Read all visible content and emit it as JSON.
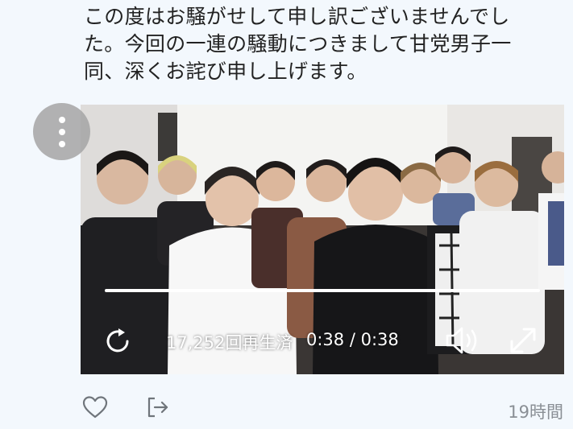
{
  "tweet": {
    "text_lines": [
      "この度はお騒がせして申し訳ございませんでし",
      "た。今回の一連の騒動につきまして甘党男子一",
      "同、深くお詫び申し上げます。"
    ],
    "timestamp": "19時間"
  },
  "video": {
    "view_count": "17,252回再生済",
    "elapsed": "0:38",
    "duration": "0:38",
    "time_display": "0:38 / 0:38",
    "progress": 1.0
  },
  "icons": {
    "more": "vertical-ellipsis-icon",
    "replay": "replay-icon",
    "volume": "speaker-icon",
    "fullscreen": "expand-arrows-icon",
    "like": "heart-outline-icon",
    "share": "share-arrow-icon"
  },
  "colors": {
    "background": "#f3f8fd",
    "text": "#222222",
    "muted": "#8a8f95",
    "video_controls": "#ffffff"
  }
}
